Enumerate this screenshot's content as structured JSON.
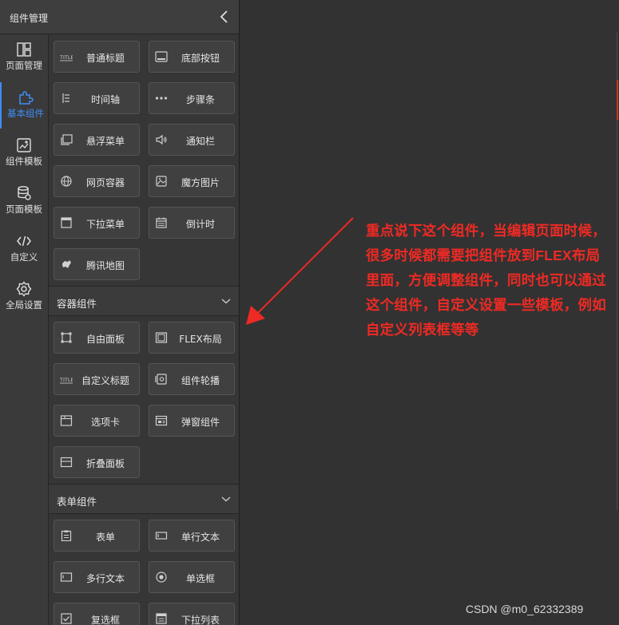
{
  "panel": {
    "title": "组件管理"
  },
  "sidebar": {
    "items": [
      {
        "label": "页面管理",
        "icon": "layout-icon",
        "active": false
      },
      {
        "label": "基本组件",
        "icon": "puzzle-icon",
        "active": true
      },
      {
        "label": "组件模板",
        "icon": "template-icon",
        "active": false
      },
      {
        "label": "页面模板",
        "icon": "database-icon",
        "active": false
      },
      {
        "label": "自定义",
        "icon": "code-icon",
        "active": false
      },
      {
        "label": "全局设置",
        "icon": "gear-icon",
        "active": false
      }
    ]
  },
  "basic": {
    "items": [
      {
        "label": "普通标题",
        "icon": "title-icon"
      },
      {
        "label": "底部按钮",
        "icon": "bottom-button-icon"
      },
      {
        "label": "时间轴",
        "icon": "timeline-icon"
      },
      {
        "label": "步骤条",
        "icon": "steps-icon"
      },
      {
        "label": "悬浮菜单",
        "icon": "float-menu-icon"
      },
      {
        "label": "通知栏",
        "icon": "speaker-icon"
      },
      {
        "label": "网页容器",
        "icon": "globe-icon"
      },
      {
        "label": "魔方图片",
        "icon": "image-icon"
      },
      {
        "label": "下拉菜单",
        "icon": "dropdown-icon"
      },
      {
        "label": "倒计时",
        "icon": "calendar-icon"
      },
      {
        "label": "腾讯地图",
        "icon": "map-icon"
      }
    ]
  },
  "container": {
    "title": "容器组件",
    "items": [
      {
        "label": "自由面板",
        "icon": "free-panel-icon"
      },
      {
        "label": "FLEX布局",
        "icon": "flex-icon"
      },
      {
        "label": "自定义标题",
        "icon": "title-icon"
      },
      {
        "label": "组件轮播",
        "icon": "carousel-icon"
      },
      {
        "label": "选项卡",
        "icon": "tabs-icon"
      },
      {
        "label": "弹窗组件",
        "icon": "dialog-icon"
      },
      {
        "label": "折叠面板",
        "icon": "collapse-panel-icon"
      }
    ]
  },
  "form": {
    "title": "表单组件",
    "items": [
      {
        "label": "表单",
        "icon": "clipboard-icon"
      },
      {
        "label": "单行文本",
        "icon": "input-icon"
      },
      {
        "label": "多行文本",
        "icon": "textarea-icon"
      },
      {
        "label": "单选框",
        "icon": "radio-icon"
      },
      {
        "label": "复选框",
        "icon": "checkbox-icon"
      },
      {
        "label": "下拉列表",
        "icon": "select-icon"
      }
    ]
  },
  "annotation": {
    "text": "重点说下这个组件，当编辑页面时候，很多时候都需要把组件放到FLEX布局里面，方便调整组件，同时也可以通过这个组件，自定义设置一些模板，例如自定义列表框等等",
    "color": "#ee2a24"
  },
  "watermark": "CSDN @m0_62332389",
  "colors": {
    "accent": "#3e8ef7",
    "background": "#323232",
    "panel": "#3a3a3a"
  }
}
